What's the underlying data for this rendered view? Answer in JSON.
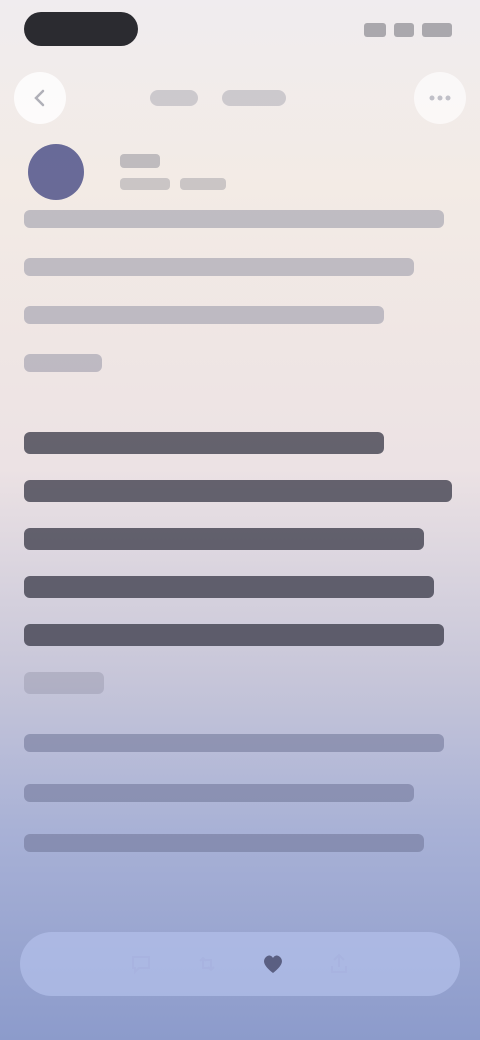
{
  "nav": {
    "back_icon": "back-icon",
    "menu_icon": "more-icon"
  },
  "colors": {
    "accent": "#50538a",
    "toolbar": "#b4c0eb",
    "text_dark": "#2a2a33"
  },
  "toolbar": {
    "icons": [
      "reply-icon",
      "retweet-icon",
      "like-icon",
      "share-icon"
    ]
  }
}
